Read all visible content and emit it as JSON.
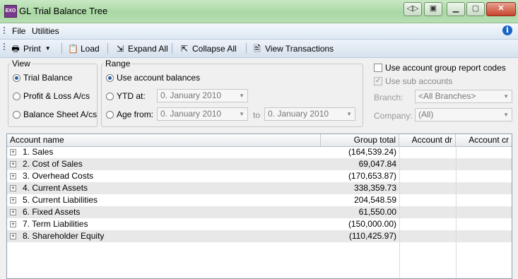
{
  "window": {
    "title": "GL Trial Balance Tree",
    "icon_label": "EXO",
    "buttons": [
      "restore-nav",
      "layout",
      "minimize",
      "maximize",
      "close"
    ]
  },
  "menu": {
    "items": [
      "File",
      "Utilities"
    ]
  },
  "toolbar": {
    "print": "Print",
    "load": "Load",
    "expand_all": "Expand All",
    "collapse_all": "Collapse All",
    "view_transactions": "View Transactions"
  },
  "view": {
    "label": "View",
    "options": [
      "Trial Balance",
      "Profit & Loss A/cs",
      "Balance Sheet A/cs"
    ],
    "selected": "Trial Balance"
  },
  "range": {
    "label": "Range",
    "use_balances": "Use account balances",
    "ytd_label": "YTD at:",
    "ytd_value": "0. January 2010",
    "age_label": "Age from:",
    "age_from": "0. January 2010",
    "to_label": "to",
    "age_to": "0. January 2010",
    "selected": "Use account balances"
  },
  "options": {
    "use_group_codes": "Use account group report codes",
    "use_sub_accounts": "Use sub accounts",
    "branch_label": "Branch:",
    "branch_value": "<All Branches>",
    "company_label": "Company:",
    "company_value": "(All)"
  },
  "grid": {
    "columns": [
      "Account name",
      "Group total",
      "Account dr",
      "Account cr"
    ],
    "rows": [
      {
        "name": "1. Sales",
        "total": "(164,539.24)"
      },
      {
        "name": "2. Cost of Sales",
        "total": "69,047.84"
      },
      {
        "name": "3. Overhead Costs",
        "total": "(170,653.87)"
      },
      {
        "name": "4. Current Assets",
        "total": "338,359.73"
      },
      {
        "name": "5. Current Liabilities",
        "total": "204,548.59"
      },
      {
        "name": "6. Fixed Assets",
        "total": "61,550.00"
      },
      {
        "name": "7. Term Liabilities",
        "total": "(150,000.00)"
      },
      {
        "name": "8. Shareholder Equity",
        "total": "(110,425.97)"
      }
    ]
  },
  "colors": {
    "titlebar": "#b7dfb2",
    "accent": "#1a63c7",
    "alt_row": "#e8e8e8"
  }
}
